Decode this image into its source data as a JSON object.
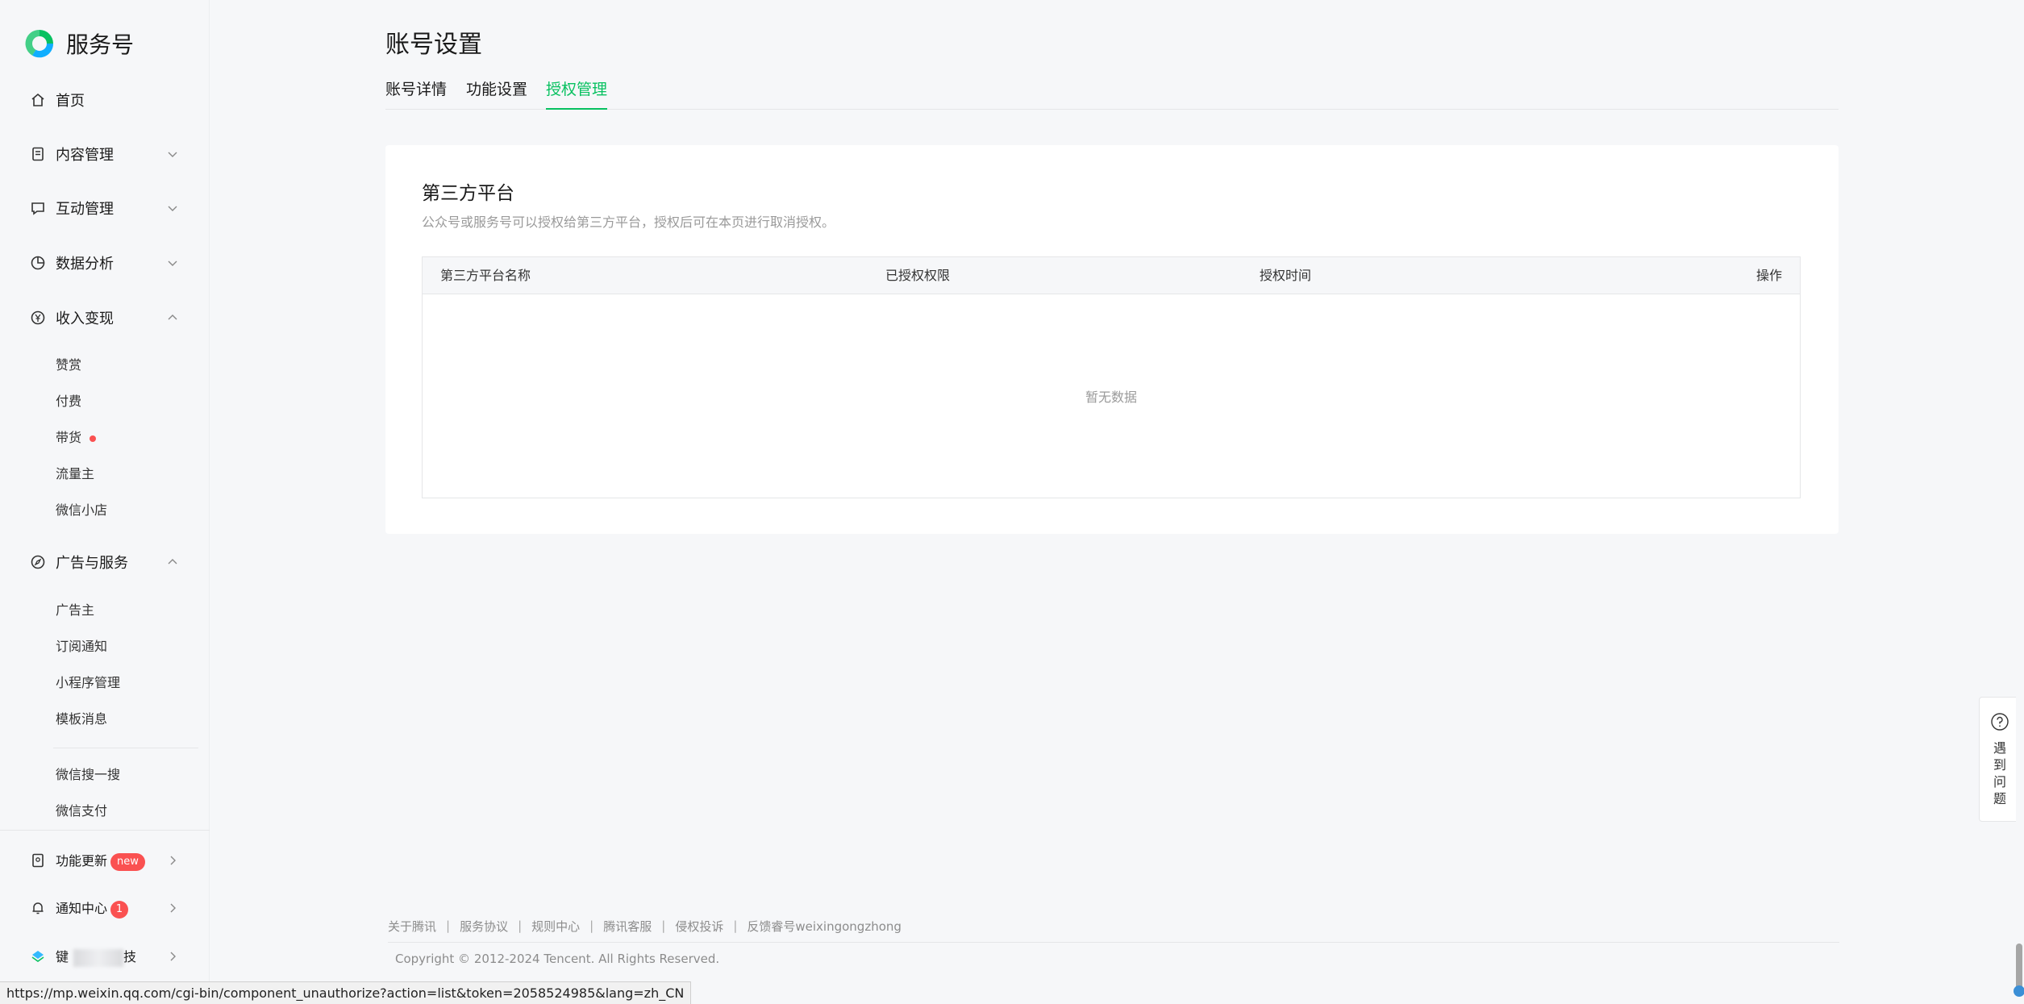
{
  "app": {
    "logo_text": "服务号"
  },
  "sidebar": {
    "home": "首页",
    "content_mgmt": "内容管理",
    "interaction_mgmt": "互动管理",
    "data_analysis": "数据分析",
    "income": "收入变现",
    "income_items": [
      "赞赏",
      "付费",
      "带货",
      "流量主",
      "微信小店"
    ],
    "ads": "广告与服务",
    "ads_items": [
      "广告主",
      "订阅通知",
      "小程序管理",
      "模板消息"
    ],
    "ads_items2": [
      "微信搜一搜",
      "微信支付"
    ],
    "feature_update": "功能更新",
    "feature_update_badge": "new",
    "notice_center": "通知中心",
    "notice_badge": "1",
    "bottom_item_prefix": "键",
    "bottom_item_suffix": "技"
  },
  "page": {
    "title": "账号设置",
    "tabs": [
      "账号详情",
      "功能设置",
      "授权管理"
    ],
    "active_tab": "授权管理"
  },
  "card": {
    "title": "第三方平台",
    "desc": "公众号或服务号可以授权给第三方平台，授权后可在本页进行取消授权。",
    "columns": [
      "第三方平台名称",
      "已授权权限",
      "授权时间",
      "操作"
    ],
    "empty": "暂无数据"
  },
  "footer": {
    "links": [
      "关于腾讯",
      "服务协议",
      "规则中心",
      "腾讯客服",
      "侵权投诉",
      "反馈睿号weixingongzhong"
    ],
    "copyright": "Copyright © 2012-2024 Tencent. All Rights Reserved."
  },
  "help": {
    "chars": [
      "遇",
      "到",
      "问",
      "题"
    ]
  },
  "statusbar": {
    "url": "https://mp.weixin.qq.com/cgi-bin/component_unauthorize?action=list&token=2058524985&lang=zh_CN"
  },
  "colors": {
    "accent": "#07c160",
    "badge": "#fa5151"
  }
}
